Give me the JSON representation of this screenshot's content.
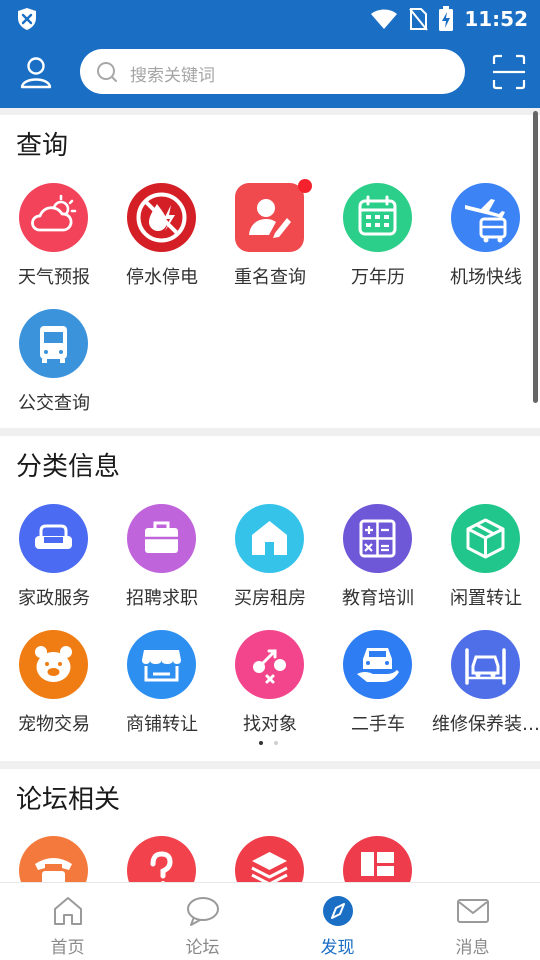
{
  "status_bar": {
    "time": "11:52"
  },
  "header": {
    "search_placeholder": "搜索关键词"
  },
  "sections": {
    "query": {
      "title": "查询",
      "items": [
        {
          "label": "天气预报",
          "icon": "weather-icon",
          "color": "#f2435a"
        },
        {
          "label": "停水停电",
          "icon": "no-water-power-icon",
          "color": "#d41f26"
        },
        {
          "label": "重名查询",
          "icon": "name-search-icon",
          "color": "#f04a4f",
          "badge": true
        },
        {
          "label": "万年历",
          "icon": "calendar-icon",
          "color": "#2ccf89"
        },
        {
          "label": "机场快线",
          "icon": "airport-bus-icon",
          "color": "#3c83f6"
        },
        {
          "label": "公交查询",
          "icon": "bus-icon",
          "color": "#3b93dc"
        }
      ]
    },
    "classifieds": {
      "title": "分类信息",
      "items": [
        {
          "label": "家政服务",
          "icon": "sofa-icon",
          "color": "#4a6bf2"
        },
        {
          "label": "招聘求职",
          "icon": "briefcase-icon",
          "color": "#c064dc"
        },
        {
          "label": "买房租房",
          "icon": "house-icon",
          "color": "#36c3ea"
        },
        {
          "label": "教育培训",
          "icon": "calculator-icon",
          "color": "#6f58d8"
        },
        {
          "label": "闲置转让",
          "icon": "box-icon",
          "color": "#21c68d"
        },
        {
          "label": "宠物交易",
          "icon": "pet-icon",
          "color": "#ef7d14"
        },
        {
          "label": "商铺转让",
          "icon": "shop-icon",
          "color": "#2d8ff0"
        },
        {
          "label": "找对象",
          "icon": "gender-icon",
          "color": "#f2458c"
        },
        {
          "label": "二手车",
          "icon": "used-car-icon",
          "color": "#2f7df2"
        },
        {
          "label": "维修保养装…",
          "icon": "car-lift-icon",
          "color": "#4e6fe8"
        }
      ]
    },
    "forum": {
      "title": "论坛相关",
      "items": [
        {
          "label": "",
          "icon": "telephone-icon",
          "color": "#f37a3c"
        },
        {
          "label": "",
          "icon": "question-icon",
          "color": "#f2434d"
        },
        {
          "label": "",
          "icon": "layers-icon",
          "color": "#ef3d49"
        },
        {
          "label": "",
          "icon": "grid-icon",
          "color": "#ef3c4d"
        }
      ]
    }
  },
  "tabbar": {
    "tabs": [
      {
        "label": "首页",
        "icon": "home-icon",
        "active": false
      },
      {
        "label": "论坛",
        "icon": "chat-icon",
        "active": false
      },
      {
        "label": "发现",
        "icon": "compass-icon",
        "active": true
      },
      {
        "label": "消息",
        "icon": "mail-icon",
        "active": false
      }
    ]
  },
  "colors": {
    "brand": "#1a6fc4",
    "active_tab": "#1a6fc4",
    "inactive_tab": "#8a8a8a"
  }
}
